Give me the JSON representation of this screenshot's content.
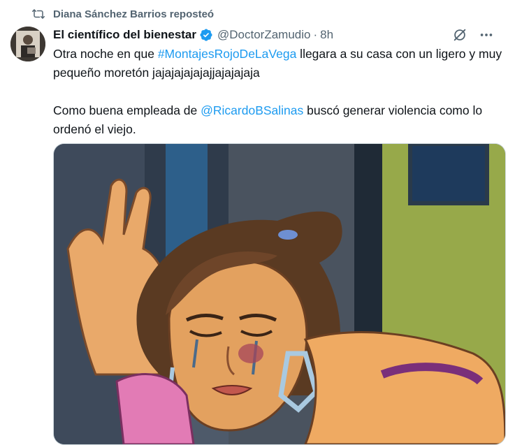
{
  "repost": {
    "text": "Diana Sánchez Barrios reposteó",
    "icon": "repost-icon"
  },
  "author": {
    "display_name": "El científico del bienestar",
    "handle": "@DoctorZamudio",
    "separator": "·",
    "time": "8h",
    "verified_icon": "verified-badge-icon"
  },
  "tweet": {
    "line1_pre": "Otra noche en que ",
    "hashtag": "#MontajesRojoDeLaVega",
    "line1_post": " llegara a su casa con un ligero y muy pequeño moretón jajajajajajajjajajajaja",
    "line2_pre": "Como buena empleada de ",
    "mention": "@RicardoBSalinas",
    "line2_post": " buscó generar violencia como lo ordenó el viejo."
  },
  "icons": {
    "grok": "grok-icon",
    "more": "more-icon"
  },
  "colors": {
    "link": "#1d9bf0",
    "secondary": "#536471",
    "verified": "#1d9bf0"
  }
}
